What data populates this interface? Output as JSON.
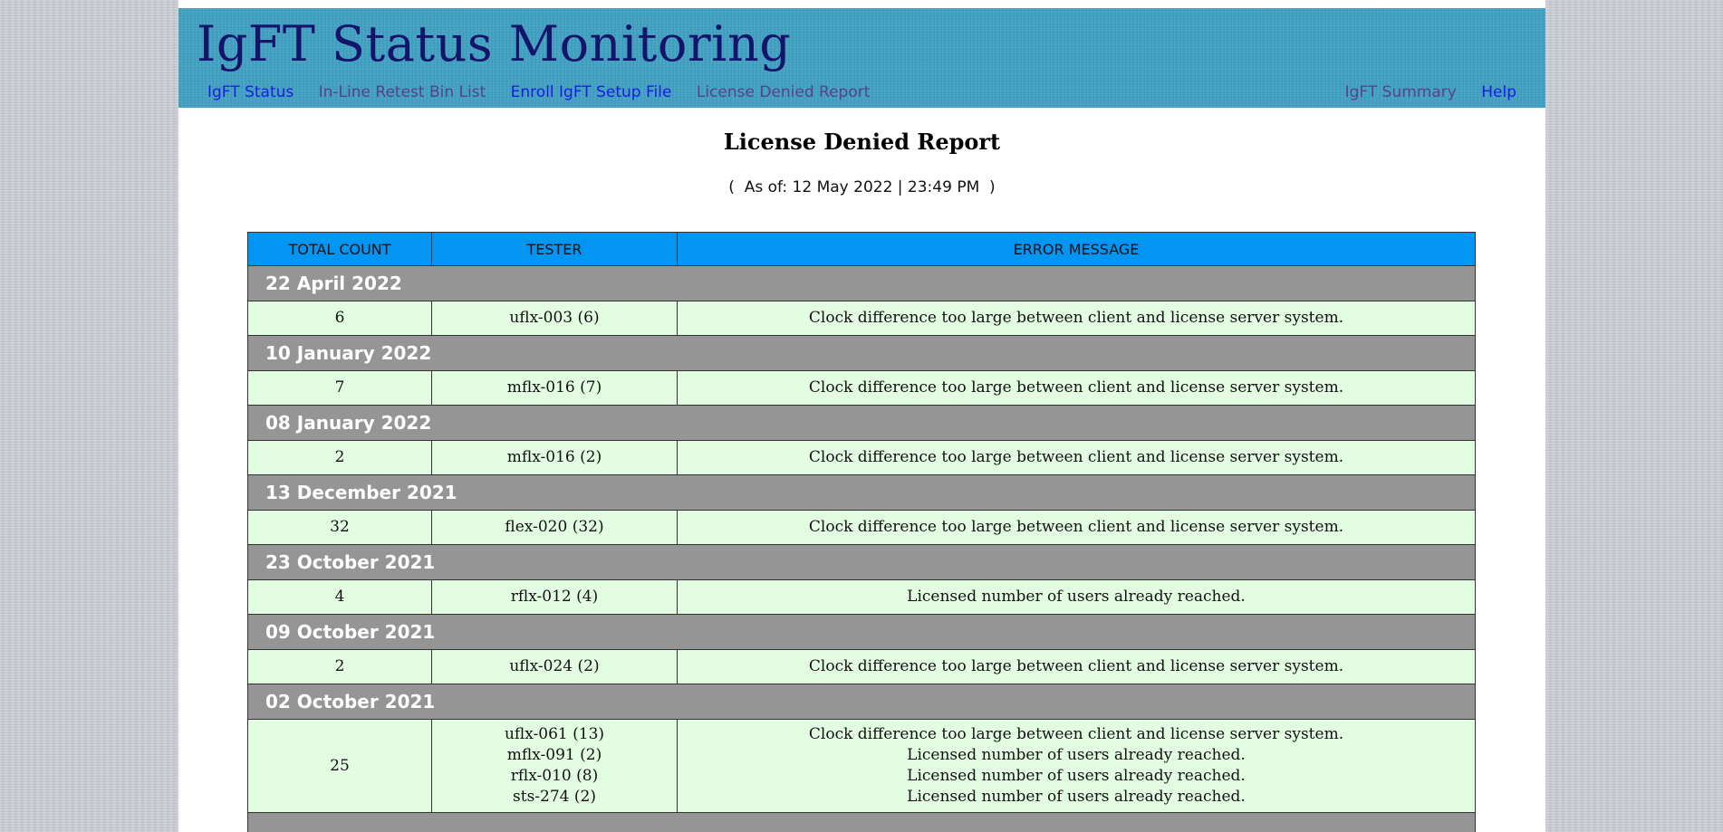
{
  "header": {
    "title": "IgFT Status Monitoring",
    "nav_left": [
      "IgFT Status",
      "In-Line Retest Bin List",
      "Enroll IgFT Setup File",
      "License Denied Report"
    ],
    "nav_right": [
      "IgFT Summary",
      "Help"
    ]
  },
  "report": {
    "title": "License Denied Report",
    "as_of": "(  As of: 12 May 2022 | 23:49 PM  )"
  },
  "table": {
    "columns": [
      "TOTAL COUNT",
      "TESTER",
      "ERROR MESSAGE"
    ],
    "groups": [
      {
        "date": "22 April 2022",
        "total": "6",
        "testers": [
          "uflx-003 (6)"
        ],
        "messages": [
          "Clock difference too large between client and license server system."
        ]
      },
      {
        "date": "10 January 2022",
        "total": "7",
        "testers": [
          "mflx-016 (7)"
        ],
        "messages": [
          "Clock difference too large between client and license server system."
        ]
      },
      {
        "date": "08 January 2022",
        "total": "2",
        "testers": [
          "mflx-016 (2)"
        ],
        "messages": [
          "Clock difference too large between client and license server system."
        ]
      },
      {
        "date": "13 December 2021",
        "total": "32",
        "testers": [
          "flex-020 (32)"
        ],
        "messages": [
          "Clock difference too large between client and license server system."
        ]
      },
      {
        "date": "23 October 2021",
        "total": "4",
        "testers": [
          "rflx-012 (4)"
        ],
        "messages": [
          "Licensed number of users already reached."
        ]
      },
      {
        "date": "09 October 2021",
        "total": "2",
        "testers": [
          "uflx-024 (2)"
        ],
        "messages": [
          "Clock difference too large between client and license server system."
        ]
      },
      {
        "date": "02 October 2021",
        "total": "25",
        "testers": [
          "uflx-061 (13)",
          "mflx-091 (2)",
          "rflx-010 (8)",
          "sts-274 (2)"
        ],
        "messages": [
          "Clock difference too large between client and license server system.",
          "Licensed number of users already reached.",
          "Licensed number of users already reached.",
          "Licensed number of users already reached."
        ]
      }
    ]
  }
}
